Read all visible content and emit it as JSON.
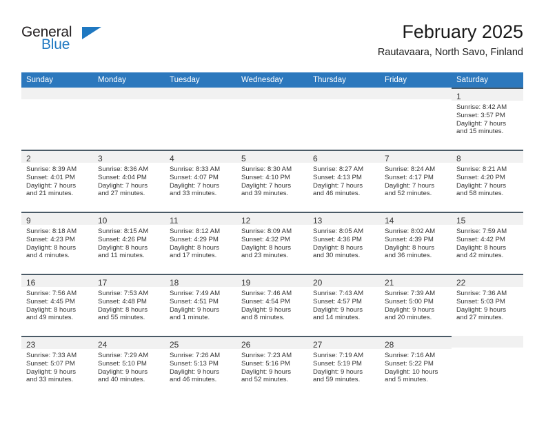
{
  "brand": {
    "name_top": "General",
    "name_bottom": "Blue",
    "accent_color": "#1f78c1"
  },
  "header": {
    "title": "February 2025",
    "subtitle": "Rautavaara, North Savo, Finland"
  },
  "calendar": {
    "header_color": "#2c78bd",
    "weekdays": [
      "Sunday",
      "Monday",
      "Tuesday",
      "Wednesday",
      "Thursday",
      "Friday",
      "Saturday"
    ],
    "labels": {
      "sunrise": "Sunrise:",
      "sunset": "Sunset:",
      "daylight": "Daylight:"
    },
    "weeks": [
      [
        {
          "day": ""
        },
        {
          "day": ""
        },
        {
          "day": ""
        },
        {
          "day": ""
        },
        {
          "day": ""
        },
        {
          "day": ""
        },
        {
          "day": "1",
          "sunrise": "Sunrise: 8:42 AM",
          "sunset": "Sunset: 3:57 PM",
          "daylight_line1": "Daylight: 7 hours",
          "daylight_line2": "and 15 minutes."
        }
      ],
      [
        {
          "day": "2",
          "sunrise": "Sunrise: 8:39 AM",
          "sunset": "Sunset: 4:01 PM",
          "daylight_line1": "Daylight: 7 hours",
          "daylight_line2": "and 21 minutes."
        },
        {
          "day": "3",
          "sunrise": "Sunrise: 8:36 AM",
          "sunset": "Sunset: 4:04 PM",
          "daylight_line1": "Daylight: 7 hours",
          "daylight_line2": "and 27 minutes."
        },
        {
          "day": "4",
          "sunrise": "Sunrise: 8:33 AM",
          "sunset": "Sunset: 4:07 PM",
          "daylight_line1": "Daylight: 7 hours",
          "daylight_line2": "and 33 minutes."
        },
        {
          "day": "5",
          "sunrise": "Sunrise: 8:30 AM",
          "sunset": "Sunset: 4:10 PM",
          "daylight_line1": "Daylight: 7 hours",
          "daylight_line2": "and 39 minutes."
        },
        {
          "day": "6",
          "sunrise": "Sunrise: 8:27 AM",
          "sunset": "Sunset: 4:13 PM",
          "daylight_line1": "Daylight: 7 hours",
          "daylight_line2": "and 46 minutes."
        },
        {
          "day": "7",
          "sunrise": "Sunrise: 8:24 AM",
          "sunset": "Sunset: 4:17 PM",
          "daylight_line1": "Daylight: 7 hours",
          "daylight_line2": "and 52 minutes."
        },
        {
          "day": "8",
          "sunrise": "Sunrise: 8:21 AM",
          "sunset": "Sunset: 4:20 PM",
          "daylight_line1": "Daylight: 7 hours",
          "daylight_line2": "and 58 minutes."
        }
      ],
      [
        {
          "day": "9",
          "sunrise": "Sunrise: 8:18 AM",
          "sunset": "Sunset: 4:23 PM",
          "daylight_line1": "Daylight: 8 hours",
          "daylight_line2": "and 4 minutes."
        },
        {
          "day": "10",
          "sunrise": "Sunrise: 8:15 AM",
          "sunset": "Sunset: 4:26 PM",
          "daylight_line1": "Daylight: 8 hours",
          "daylight_line2": "and 11 minutes."
        },
        {
          "day": "11",
          "sunrise": "Sunrise: 8:12 AM",
          "sunset": "Sunset: 4:29 PM",
          "daylight_line1": "Daylight: 8 hours",
          "daylight_line2": "and 17 minutes."
        },
        {
          "day": "12",
          "sunrise": "Sunrise: 8:09 AM",
          "sunset": "Sunset: 4:32 PM",
          "daylight_line1": "Daylight: 8 hours",
          "daylight_line2": "and 23 minutes."
        },
        {
          "day": "13",
          "sunrise": "Sunrise: 8:05 AM",
          "sunset": "Sunset: 4:36 PM",
          "daylight_line1": "Daylight: 8 hours",
          "daylight_line2": "and 30 minutes."
        },
        {
          "day": "14",
          "sunrise": "Sunrise: 8:02 AM",
          "sunset": "Sunset: 4:39 PM",
          "daylight_line1": "Daylight: 8 hours",
          "daylight_line2": "and 36 minutes."
        },
        {
          "day": "15",
          "sunrise": "Sunrise: 7:59 AM",
          "sunset": "Sunset: 4:42 PM",
          "daylight_line1": "Daylight: 8 hours",
          "daylight_line2": "and 42 minutes."
        }
      ],
      [
        {
          "day": "16",
          "sunrise": "Sunrise: 7:56 AM",
          "sunset": "Sunset: 4:45 PM",
          "daylight_line1": "Daylight: 8 hours",
          "daylight_line2": "and 49 minutes."
        },
        {
          "day": "17",
          "sunrise": "Sunrise: 7:53 AM",
          "sunset": "Sunset: 4:48 PM",
          "daylight_line1": "Daylight: 8 hours",
          "daylight_line2": "and 55 minutes."
        },
        {
          "day": "18",
          "sunrise": "Sunrise: 7:49 AM",
          "sunset": "Sunset: 4:51 PM",
          "daylight_line1": "Daylight: 9 hours",
          "daylight_line2": "and 1 minute."
        },
        {
          "day": "19",
          "sunrise": "Sunrise: 7:46 AM",
          "sunset": "Sunset: 4:54 PM",
          "daylight_line1": "Daylight: 9 hours",
          "daylight_line2": "and 8 minutes."
        },
        {
          "day": "20",
          "sunrise": "Sunrise: 7:43 AM",
          "sunset": "Sunset: 4:57 PM",
          "daylight_line1": "Daylight: 9 hours",
          "daylight_line2": "and 14 minutes."
        },
        {
          "day": "21",
          "sunrise": "Sunrise: 7:39 AM",
          "sunset": "Sunset: 5:00 PM",
          "daylight_line1": "Daylight: 9 hours",
          "daylight_line2": "and 20 minutes."
        },
        {
          "day": "22",
          "sunrise": "Sunrise: 7:36 AM",
          "sunset": "Sunset: 5:03 PM",
          "daylight_line1": "Daylight: 9 hours",
          "daylight_line2": "and 27 minutes."
        }
      ],
      [
        {
          "day": "23",
          "sunrise": "Sunrise: 7:33 AM",
          "sunset": "Sunset: 5:07 PM",
          "daylight_line1": "Daylight: 9 hours",
          "daylight_line2": "and 33 minutes."
        },
        {
          "day": "24",
          "sunrise": "Sunrise: 7:29 AM",
          "sunset": "Sunset: 5:10 PM",
          "daylight_line1": "Daylight: 9 hours",
          "daylight_line2": "and 40 minutes."
        },
        {
          "day": "25",
          "sunrise": "Sunrise: 7:26 AM",
          "sunset": "Sunset: 5:13 PM",
          "daylight_line1": "Daylight: 9 hours",
          "daylight_line2": "and 46 minutes."
        },
        {
          "day": "26",
          "sunrise": "Sunrise: 7:23 AM",
          "sunset": "Sunset: 5:16 PM",
          "daylight_line1": "Daylight: 9 hours",
          "daylight_line2": "and 52 minutes."
        },
        {
          "day": "27",
          "sunrise": "Sunrise: 7:19 AM",
          "sunset": "Sunset: 5:19 PM",
          "daylight_line1": "Daylight: 9 hours",
          "daylight_line2": "and 59 minutes."
        },
        {
          "day": "28",
          "sunrise": "Sunrise: 7:16 AM",
          "sunset": "Sunset: 5:22 PM",
          "daylight_line1": "Daylight: 10 hours",
          "daylight_line2": "and 5 minutes."
        },
        {
          "day": ""
        }
      ]
    ]
  }
}
